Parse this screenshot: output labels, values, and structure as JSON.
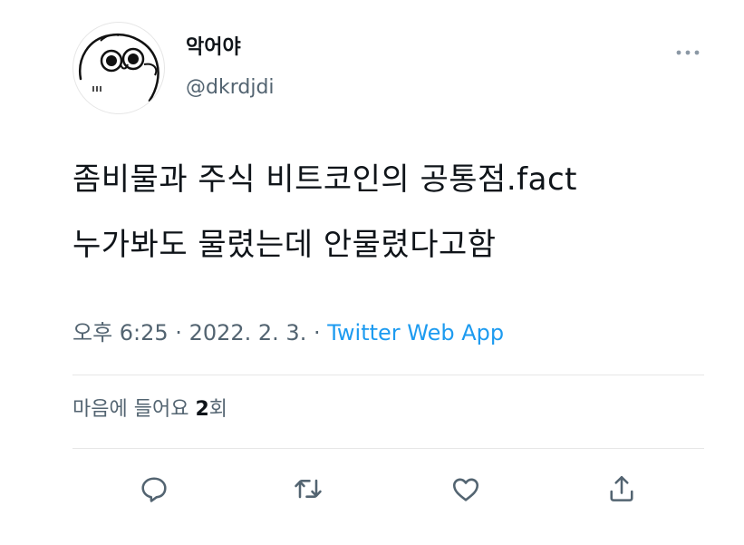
{
  "user": {
    "display_name": "악어야",
    "handle": "@dkrdjdi",
    "avatar_icon": "cartoon-bird-avatar"
  },
  "tweet": {
    "lines": [
      "좀비물과 주식 비트코인의 공통점.fact",
      "누가봐도 물렸는데 안물렸다고함"
    ]
  },
  "meta": {
    "time_date": "오후 6:25 · 2022. 2. 3. · ",
    "source": "Twitter Web App"
  },
  "likes": {
    "label": "마음에 들어요 ",
    "count": "2",
    "unit": "회"
  },
  "actions": {
    "reply_icon": "reply-icon",
    "retweet_icon": "retweet-icon",
    "like_icon": "like-icon",
    "share_icon": "share-icon"
  },
  "colors": {
    "text": "#0f1419",
    "secondary": "#536471",
    "link": "#1d9bf0",
    "divider": "#e7e7e7"
  }
}
